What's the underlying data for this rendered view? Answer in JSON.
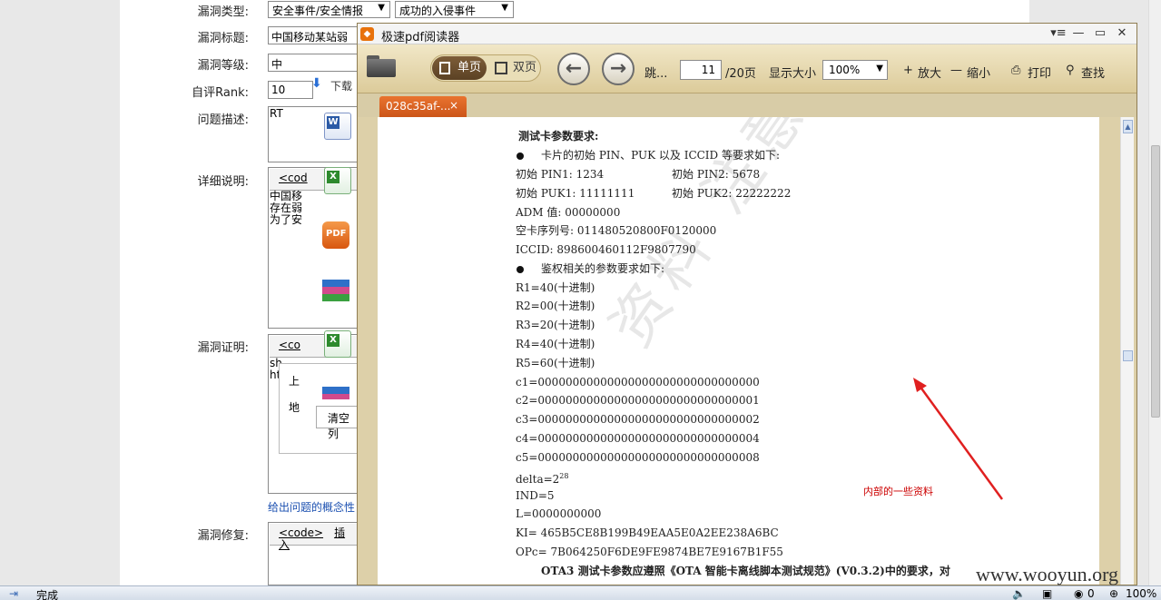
{
  "form": {
    "type_label": "漏洞类型:",
    "type_value": "安全事件/安全情报",
    "subtype_value": "成功的入侵事件",
    "title_label": "漏洞标题:",
    "title_value": "中国移动某站弱",
    "level_label": "漏洞等级:",
    "level_value": "中",
    "rank_label": "自评Rank:",
    "rank_value": "10",
    "desc_label": "问题描述:",
    "desc_value": "RT",
    "detail_label": "详细说明:",
    "detail_lines": [
      "中国移",
      "存在弱",
      "为了安"
    ],
    "proof_label": "漏洞证明:",
    "proof_lines": [
      "sh",
      "ht"
    ],
    "fix_label": "漏洞修复:",
    "code_tab": "<code>",
    "insert_tab": "插入",
    "code_partial": "<cod",
    "code_partial2": "<co",
    "download_text": "下载",
    "upload_text": "上",
    "address_text": "地",
    "clear_btn": "清空列",
    "hint_link": "给出问题的概念性"
  },
  "pdf_reader": {
    "app_title": "极速pdf阅读器",
    "single_page": "单页",
    "double_page": "双页",
    "jump": "跳...",
    "current_page": "11",
    "total_pages": "/20页",
    "zoom_label": "显示大小",
    "zoom_value": "100%",
    "zoom_in": "放大",
    "zoom_out": "缩小",
    "print": "打印",
    "find": "查找",
    "tab_name": "028c35af-...",
    "tab_close": "×",
    "win_menu": "▾≡",
    "win_min": "—",
    "win_max": "▭",
    "win_close": "✕"
  },
  "pdf_content": {
    "heading": "测试卡参数要求:",
    "bullet1": "卡片的初始 PIN、PUK 以及 ICCID 等要求如下:",
    "pin1": "初始 PIN1: 1234",
    "pin2": "初始 PIN2: 5678",
    "puk1": "初始 PUK1: 11111111",
    "puk2": "初始 PUK2: 22222222",
    "adm": "ADM 值: 00000000",
    "serial": "空卡序列号: 011480520800F0120000",
    "iccid": "ICCID: 898600460112F9807790",
    "bullet2": "鉴权相关的参数要求如下:",
    "r1": "R1=40(十进制)",
    "r2": "R2=00(十进制)",
    "r3": "R3=20(十进制)",
    "r4": "R4=40(十进制)",
    "r5": "R5=60(十进制)",
    "c1": "c1=00000000000000000000000000000000",
    "c2": "c2=00000000000000000000000000000001",
    "c3": "c3=00000000000000000000000000000002",
    "c4": "c4=00000000000000000000000000000004",
    "c5": "c5=00000000000000000000000000000008",
    "delta": "delta=2",
    "delta_exp": "28",
    "ind": "IND=5",
    "l": "L=0000000000",
    "ki": "KI= 465B5CE8B199B49EAA5E0A2EE238A6BC",
    "opc": "OPc= 7B064250F6DE9FE9874BE7E9167B1F55",
    "footer": "OTA3 测试卡参数应遵照《OTA 智能卡离线脚本测试规范》(V0.3.2)中的要求，对",
    "watermark": "资料 注意保密",
    "annotation": "内部的一些资料"
  },
  "status": {
    "text": "完成",
    "count": "0",
    "zoom": "100%"
  },
  "site_watermark": "www.wooyun.org"
}
